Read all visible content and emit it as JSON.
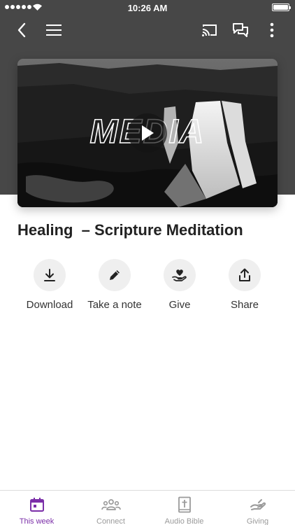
{
  "status_bar": {
    "time": "10:26 AM"
  },
  "toolbar": {
    "back_icon": "chevron-left-icon",
    "menu_icon": "hamburger-menu-icon",
    "cast_icon": "cast-icon",
    "chat_icon": "chat-bubbles-icon",
    "more_icon": "vertical-dots-icon"
  },
  "media": {
    "wordmark": "MEDIA",
    "play_icon": "play-icon"
  },
  "title": "Healing  – Scripture Meditation",
  "actions": [
    {
      "label": "Download",
      "icon": "download-icon"
    },
    {
      "label": "Take a note",
      "icon": "pencil-icon"
    },
    {
      "label": "Give",
      "icon": "heart-hand-icon"
    },
    {
      "label": "Share",
      "icon": "share-icon"
    }
  ],
  "tabs": [
    {
      "label": "This week",
      "icon": "calendar-icon",
      "active": true
    },
    {
      "label": "Connect",
      "icon": "people-icon",
      "active": false
    },
    {
      "label": "Audio Bible",
      "icon": "bible-icon",
      "active": false
    },
    {
      "label": "Giving",
      "icon": "giving-hand-icon",
      "active": false
    }
  ],
  "colors": {
    "header_bg": "#474747",
    "accent": "#7b2fa8",
    "tab_inactive": "#9a9a9a",
    "action_circle": "#efefef"
  }
}
